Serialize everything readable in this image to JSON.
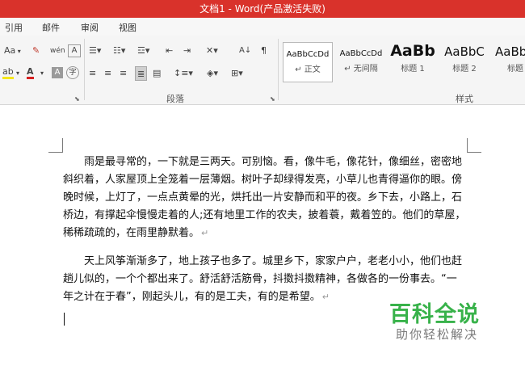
{
  "window": {
    "title": "文档1 - Word(产品激活失败)"
  },
  "menu": {
    "items": [
      "引用",
      "邮件",
      "审阅",
      "视图"
    ]
  },
  "ribbon": {
    "font_size_label": "Aa",
    "phonetic_label": "wén",
    "char_border_label": "A",
    "highlight_label": "ab",
    "font_color_label": "A",
    "char_shading_label": "A",
    "enclose_char_label": "字",
    "sort_label": "A↓",
    "paragraph_group": "段落",
    "styles_group": "样式",
    "styles": [
      {
        "sample": "AaBbCcDd",
        "name": "↵ 正文"
      },
      {
        "sample": "AaBbCcDd",
        "name": "↵ 无间隔"
      },
      {
        "sample": "AaBb",
        "name": "标题 1"
      },
      {
        "sample": "AaBbC",
        "name": "标题 2"
      },
      {
        "sample": "AaBb",
        "name": "标题"
      }
    ]
  },
  "document": {
    "paragraphs": [
      "雨是最寻常的，一下就是三两天。可别恼。看，像牛毛，像花针，像细丝，密密地斜织着，人家屋顶上全笼着一层薄烟。树叶子却绿得发亮，小草儿也青得逼你的眼。傍晚时候，上灯了，一点点黄晕的光，烘托出一片安静而和平的夜。乡下去，小路上，石桥边，有撑起伞慢慢走着的人;还有地里工作的农夫，披着蓑，戴着笠的。他们的草屋，稀稀疏疏的，在雨里静默着。",
      "天上风筝渐渐多了，地上孩子也多了。城里乡下，家家户户，老老小小，他们也赶趟儿似的，一个个都出来了。舒活舒活筋骨，抖擞抖擞精神，各做各的一份事去。“一年之计在于春”，刚起头儿，有的是工夫，有的是希望。"
    ],
    "paragraph_mark": "↵"
  },
  "watermark": {
    "title": "百科全说",
    "subtitle": "助你轻松解决"
  },
  "colors": {
    "titlebar": "#d9322b",
    "highlight": "#f5e61a",
    "font_color": "#d62020",
    "watermark": "#38b24a"
  }
}
